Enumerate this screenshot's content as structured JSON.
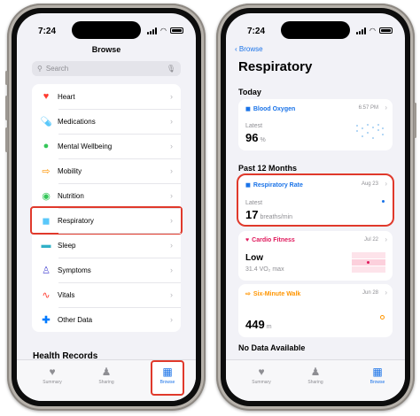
{
  "left_screen": {
    "status": {
      "time": "7:24"
    },
    "title": "Browse",
    "search_placeholder": "Search",
    "categories": [
      {
        "label": "Heart",
        "icon": "heart-icon",
        "color": "#ff3b30"
      },
      {
        "label": "Medications",
        "icon": "pills-icon",
        "color": "#5ac8fa"
      },
      {
        "label": "Mental Wellbeing",
        "icon": "head-icon",
        "color": "#34c759"
      },
      {
        "label": "Mobility",
        "icon": "arrows-icon",
        "color": "#ff9500"
      },
      {
        "label": "Nutrition",
        "icon": "apple-icon",
        "color": "#34c759"
      },
      {
        "label": "Respiratory",
        "icon": "lungs-icon",
        "color": "#5ac8fa"
      },
      {
        "label": "Sleep",
        "icon": "bed-icon",
        "color": "#30b0c7"
      },
      {
        "label": "Symptoms",
        "icon": "person-icon",
        "color": "#5856d6"
      },
      {
        "label": "Vitals",
        "icon": "waveform-icon",
        "color": "#ff3b30"
      },
      {
        "label": "Other Data",
        "icon": "plus-icon",
        "color": "#007aff"
      }
    ],
    "health_records_heading": "Health Records",
    "tabs": [
      {
        "label": "Summary",
        "icon": "heart-icon"
      },
      {
        "label": "Sharing",
        "icon": "people-icon"
      },
      {
        "label": "Browse",
        "icon": "grid-icon"
      }
    ]
  },
  "right_screen": {
    "status": {
      "time": "7:24"
    },
    "back_label": "Browse",
    "title": "Respiratory",
    "today_heading": "Today",
    "blood_oxygen": {
      "name": "Blood Oxygen",
      "time": "6:57 PM",
      "latest_label": "Latest",
      "value": "96",
      "unit": "%"
    },
    "past_heading": "Past 12 Months",
    "respiratory_rate": {
      "name": "Respiratory Rate",
      "date": "Aug 23",
      "latest_label": "Latest",
      "value": "17",
      "unit": "breaths/min"
    },
    "cardio_fitness": {
      "name": "Cardio Fitness",
      "date": "Jul 22",
      "value": "Low",
      "sub": "31.4 VO₂ max"
    },
    "six_minute_walk": {
      "name": "Six-Minute Walk",
      "date": "Jun 28",
      "value": "449",
      "unit": "m"
    },
    "no_data_heading": "No Data Available",
    "tabs": [
      {
        "label": "Summary"
      },
      {
        "label": "Sharing"
      },
      {
        "label": "Browse"
      }
    ]
  },
  "colors": {
    "accent": "#1a73e8",
    "highlight": "#e0392b"
  }
}
